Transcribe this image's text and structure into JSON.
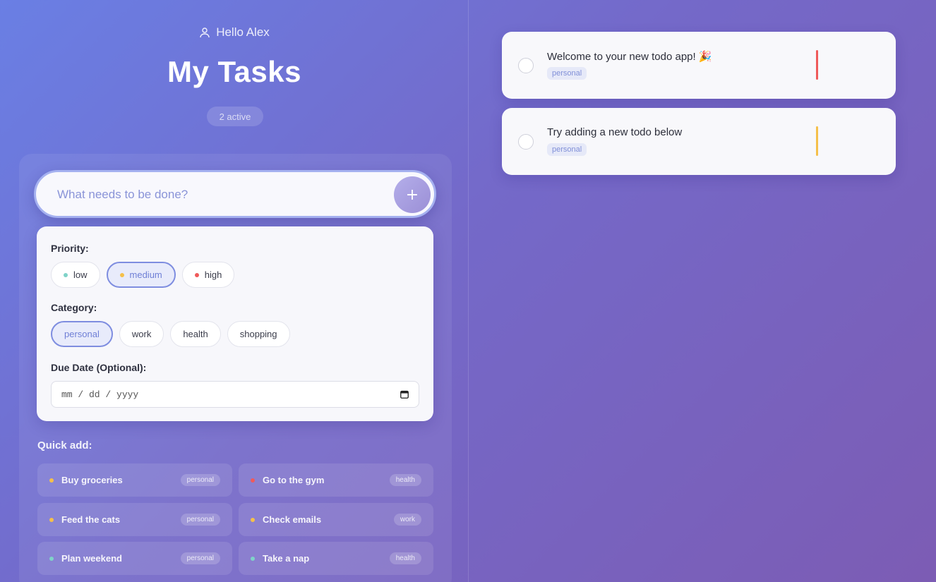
{
  "header": {
    "greeting": "Hello Alex",
    "title": "My Tasks",
    "active_count": "2 active"
  },
  "input": {
    "placeholder": "What needs to be done?",
    "add_label": "+"
  },
  "priority": {
    "label": "Priority:",
    "options": [
      {
        "label": "low",
        "color": "#7fd3c8"
      },
      {
        "label": "medium",
        "color": "#f5c04a"
      },
      {
        "label": "high",
        "color": "#ef5a5a"
      }
    ],
    "selected": "medium"
  },
  "category": {
    "label": "Category:",
    "options": [
      "personal",
      "work",
      "health",
      "shopping"
    ],
    "selected": "personal"
  },
  "due_date": {
    "label": "Due Date (Optional):",
    "placeholder": "mm / dd / yyyy"
  },
  "quick_add": {
    "title": "Quick add:",
    "items": [
      {
        "label": "Buy groceries",
        "tag": "personal",
        "color": "#f5c04a"
      },
      {
        "label": "Go to the gym",
        "tag": "health",
        "color": "#ef5a5a"
      },
      {
        "label": "Feed the cats",
        "tag": "personal",
        "color": "#f5c04a"
      },
      {
        "label": "Check emails",
        "tag": "work",
        "color": "#f5c04a"
      },
      {
        "label": "Plan weekend",
        "tag": "personal",
        "color": "#7fd3c8"
      },
      {
        "label": "Take a nap",
        "tag": "health",
        "color": "#7fd3c8"
      }
    ]
  },
  "todos": [
    {
      "text": "Welcome to your new todo app! 🎉",
      "tag": "personal",
      "priority_color": "#ef5a5a"
    },
    {
      "text": "Try adding a new todo below",
      "tag": "personal",
      "priority_color": "#f5c04a"
    }
  ]
}
